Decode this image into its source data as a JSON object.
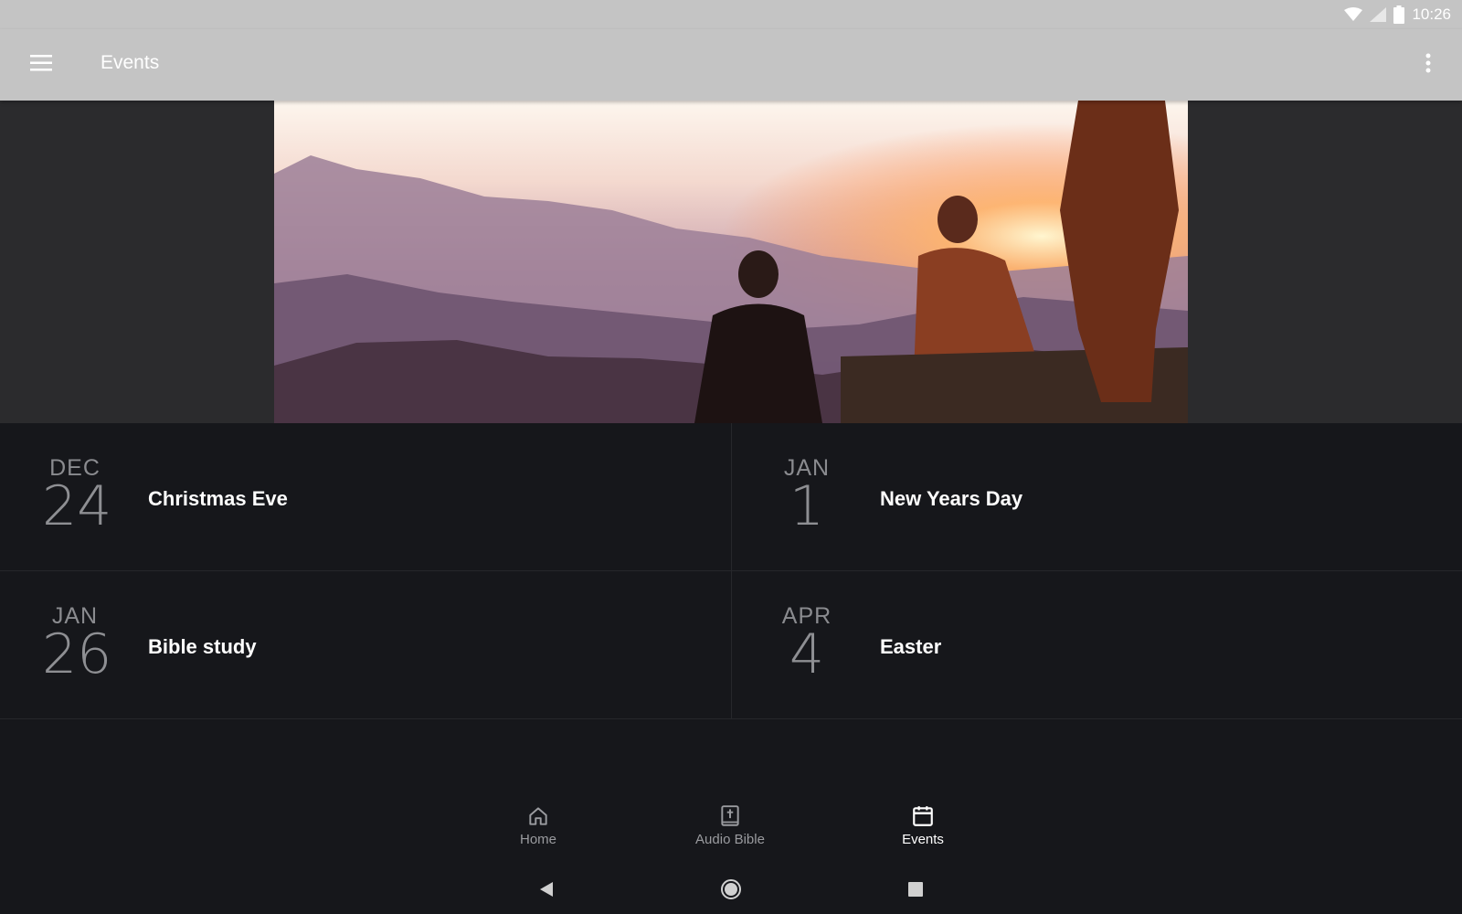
{
  "status_bar": {
    "time": "10:26",
    "icons": [
      "wifi-icon",
      "signal-icon",
      "battery-icon"
    ]
  },
  "app_bar": {
    "title": "Events",
    "menu_icon": "hamburger-menu-icon",
    "more_icon": "more-vert-icon"
  },
  "hero": {
    "description_icon": "hero-image"
  },
  "events": [
    {
      "month": "DEC",
      "day": "24",
      "name": "Christmas Eve"
    },
    {
      "month": "JAN",
      "day": "1",
      "name": "New Years Day"
    },
    {
      "month": "JAN",
      "day": "26",
      "name": "Bible study"
    },
    {
      "month": "APR",
      "day": "4",
      "name": "Easter"
    }
  ],
  "bottom_nav": {
    "items": [
      {
        "label": "Home",
        "icon": "home-icon",
        "active": false
      },
      {
        "label": "Audio Bible",
        "icon": "bible-icon",
        "active": false
      },
      {
        "label": "Events",
        "icon": "calendar-icon",
        "active": true
      }
    ]
  },
  "system_nav": {
    "icons": [
      "back-icon",
      "home-circle-icon",
      "recents-icon"
    ]
  },
  "colors": {
    "app_bar": "#c4c4c4",
    "background": "#16171b",
    "hero_band": "#2b2b2d",
    "active_tab": "#ffffff",
    "inactive_tab": "#9a9b9f"
  }
}
